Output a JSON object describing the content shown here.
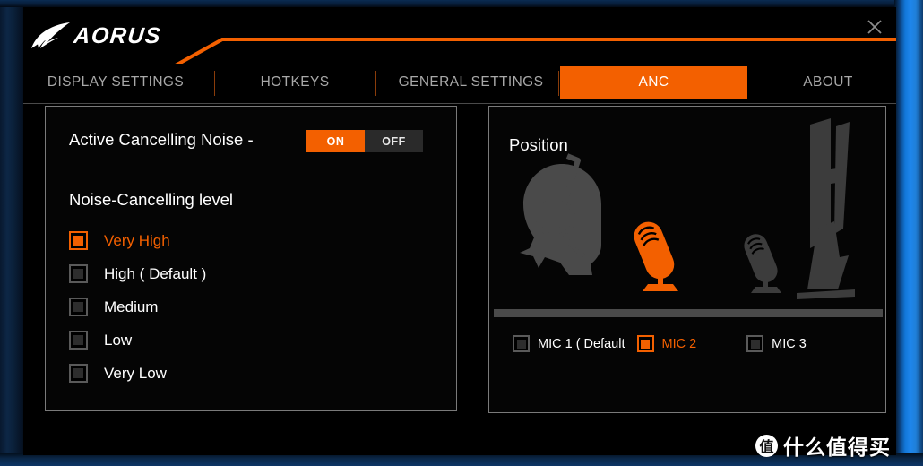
{
  "window": {
    "logo_text": "AORUS",
    "close_label": "×"
  },
  "tabs": [
    {
      "label": "DISPLAY SETTINGS",
      "active": false
    },
    {
      "label": "HOTKEYS",
      "active": false
    },
    {
      "label": "GENERAL SETTINGS",
      "active": false
    },
    {
      "label": "ANC",
      "active": true
    },
    {
      "label": "ABOUT",
      "active": false
    }
  ],
  "anc": {
    "label": "Active Cancelling Noise -",
    "toggle_on": "ON",
    "toggle_off": "OFF",
    "toggle_value": "ON",
    "level_title": "Noise-Cancelling level",
    "levels": [
      {
        "label": "Very High",
        "selected": true
      },
      {
        "label": "High ( Default )",
        "selected": false
      },
      {
        "label": "Medium",
        "selected": false
      },
      {
        "label": "Low",
        "selected": false
      },
      {
        "label": "Very Low",
        "selected": false
      }
    ]
  },
  "position": {
    "title": "Position",
    "mics": [
      {
        "label": "MIC 1 ( Default",
        "selected": false
      },
      {
        "label": "MIC 2",
        "selected": true
      },
      {
        "label": "MIC 3",
        "selected": false
      }
    ]
  },
  "watermark": {
    "badge": "值",
    "text": "什么值得买"
  },
  "colors": {
    "accent": "#f36000",
    "window_bg": "#000000",
    "panel_border": "#7a7a7a",
    "text": "#ffffff",
    "tab_inactive": "#a8a8a8",
    "icon_gray": "#4a4a4a"
  }
}
